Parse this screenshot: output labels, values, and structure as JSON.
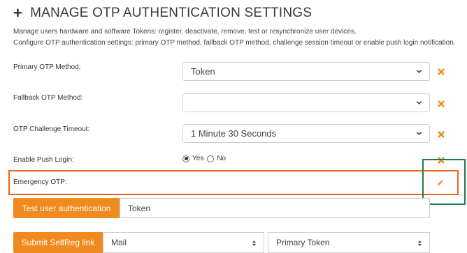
{
  "header": {
    "title": "MANAGE OTP AUTHENTICATION SETTINGS",
    "description_line1": "Manage users hardware and software Tokens: register, deactivate, remove, test or resynchronize user devices.",
    "description_line2": "Configure OTP authentication settings: primary OTP method, fallback OTP method, challenge session timeout or enable push login notification."
  },
  "settings": {
    "primary_otp_method": {
      "label": "Primary OTP Method:",
      "value": "Token"
    },
    "fallback_otp_method": {
      "label": "Fallback OTP Method:",
      "value": ""
    },
    "otp_challenge_timeout": {
      "label": "OTP Challenge Timeout:",
      "value": "1 Minute 30 Seconds"
    },
    "enable_push_login": {
      "label": "Enable Push Login:",
      "yes": "Yes",
      "no": "No",
      "selected": "Yes"
    },
    "emergency_otp": {
      "label": "Emergency OTP:"
    }
  },
  "actions": {
    "test_button": "Test user authentication",
    "test_select": "Token",
    "selfreg_button": "Submit SelfReg link",
    "selfreg_channel": "Mail",
    "selfreg_token": "Primary Token"
  },
  "colors": {
    "accent_orange": "#f08a1e",
    "highlight_orange": "#e8641c",
    "highlight_green": "#1e7a46"
  }
}
